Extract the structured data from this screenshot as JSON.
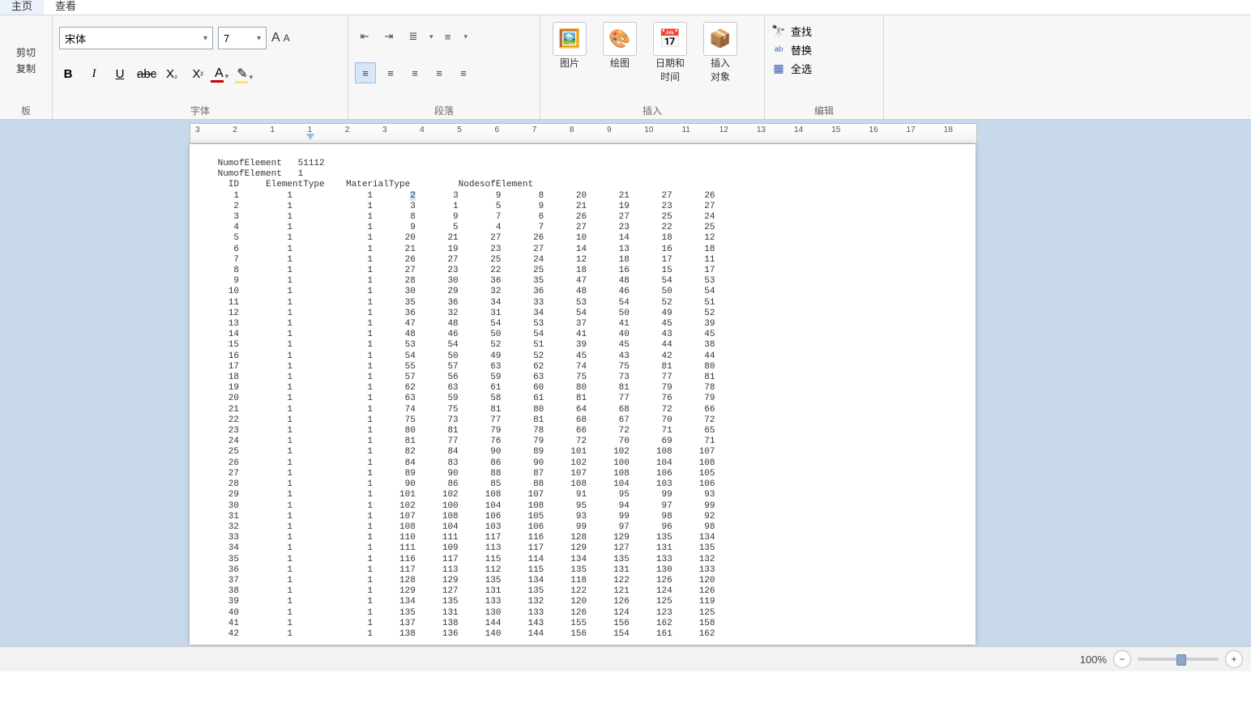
{
  "tabs": {
    "home": "主页",
    "view": "查看"
  },
  "clipboard": {
    "cut": "剪切",
    "copy": "复制",
    "group": "板"
  },
  "font": {
    "name": "宋体",
    "size": "7",
    "group": "字体",
    "bold": "B",
    "italic": "I",
    "underline": "U",
    "strike": "abc",
    "sub": "X",
    "sup": "X"
  },
  "paragraph": {
    "group": "段落"
  },
  "insert": {
    "picture": "图片",
    "paint": "绘图",
    "datetime": "日期和\n时间",
    "object": "插入\n对象",
    "group": "插入"
  },
  "edit": {
    "find": "查找",
    "replace": "替换",
    "selectall": "全选",
    "group": "编辑"
  },
  "ruler": [
    "3",
    "2",
    "1",
    "1",
    "2",
    "3",
    "4",
    "5",
    "6",
    "7",
    "8",
    "9",
    "10",
    "11",
    "12",
    "13",
    "14",
    "15",
    "16",
    "17",
    "18"
  ],
  "status": {
    "zoom": "100%"
  },
  "doc": {
    "header1": "NumofElement   51112",
    "header2": "NumofElement   1",
    "colhead": "   ID     ElementType    MaterialType         NodesofElement",
    "highlight": "2",
    "rows": [
      [
        "1",
        "1",
        "1",
        "2",
        "3",
        "9",
        "8",
        "20",
        "21",
        "27",
        "26"
      ],
      [
        "2",
        "1",
        "1",
        "3",
        "1",
        "5",
        "9",
        "21",
        "19",
        "23",
        "27"
      ],
      [
        "3",
        "1",
        "1",
        "8",
        "9",
        "7",
        "6",
        "26",
        "27",
        "25",
        "24"
      ],
      [
        "4",
        "1",
        "1",
        "9",
        "5",
        "4",
        "7",
        "27",
        "23",
        "22",
        "25"
      ],
      [
        "5",
        "1",
        "1",
        "20",
        "21",
        "27",
        "26",
        "10",
        "14",
        "18",
        "12"
      ],
      [
        "6",
        "1",
        "1",
        "21",
        "19",
        "23",
        "27",
        "14",
        "13",
        "16",
        "18"
      ],
      [
        "7",
        "1",
        "1",
        "26",
        "27",
        "25",
        "24",
        "12",
        "18",
        "17",
        "11"
      ],
      [
        "8",
        "1",
        "1",
        "27",
        "23",
        "22",
        "25",
        "18",
        "16",
        "15",
        "17"
      ],
      [
        "9",
        "1",
        "1",
        "28",
        "30",
        "36",
        "35",
        "47",
        "48",
        "54",
        "53"
      ],
      [
        "10",
        "1",
        "1",
        "30",
        "29",
        "32",
        "36",
        "48",
        "46",
        "50",
        "54"
      ],
      [
        "11",
        "1",
        "1",
        "35",
        "36",
        "34",
        "33",
        "53",
        "54",
        "52",
        "51"
      ],
      [
        "12",
        "1",
        "1",
        "36",
        "32",
        "31",
        "34",
        "54",
        "50",
        "49",
        "52"
      ],
      [
        "13",
        "1",
        "1",
        "47",
        "48",
        "54",
        "53",
        "37",
        "41",
        "45",
        "39"
      ],
      [
        "14",
        "1",
        "1",
        "48",
        "46",
        "50",
        "54",
        "41",
        "40",
        "43",
        "45"
      ],
      [
        "15",
        "1",
        "1",
        "53",
        "54",
        "52",
        "51",
        "39",
        "45",
        "44",
        "38"
      ],
      [
        "16",
        "1",
        "1",
        "54",
        "50",
        "49",
        "52",
        "45",
        "43",
        "42",
        "44"
      ],
      [
        "17",
        "1",
        "1",
        "55",
        "57",
        "63",
        "62",
        "74",
        "75",
        "81",
        "80"
      ],
      [
        "18",
        "1",
        "1",
        "57",
        "56",
        "59",
        "63",
        "75",
        "73",
        "77",
        "81"
      ],
      [
        "19",
        "1",
        "1",
        "62",
        "63",
        "61",
        "60",
        "80",
        "81",
        "79",
        "78"
      ],
      [
        "20",
        "1",
        "1",
        "63",
        "59",
        "58",
        "61",
        "81",
        "77",
        "76",
        "79"
      ],
      [
        "21",
        "1",
        "1",
        "74",
        "75",
        "81",
        "80",
        "64",
        "68",
        "72",
        "66"
      ],
      [
        "22",
        "1",
        "1",
        "75",
        "73",
        "77",
        "81",
        "68",
        "67",
        "70",
        "72"
      ],
      [
        "23",
        "1",
        "1",
        "80",
        "81",
        "79",
        "78",
        "66",
        "72",
        "71",
        "65"
      ],
      [
        "24",
        "1",
        "1",
        "81",
        "77",
        "76",
        "79",
        "72",
        "70",
        "69",
        "71"
      ],
      [
        "25",
        "1",
        "1",
        "82",
        "84",
        "90",
        "89",
        "101",
        "102",
        "108",
        "107"
      ],
      [
        "26",
        "1",
        "1",
        "84",
        "83",
        "86",
        "90",
        "102",
        "100",
        "104",
        "108"
      ],
      [
        "27",
        "1",
        "1",
        "89",
        "90",
        "88",
        "87",
        "107",
        "108",
        "106",
        "105"
      ],
      [
        "28",
        "1",
        "1",
        "90",
        "86",
        "85",
        "88",
        "108",
        "104",
        "103",
        "106"
      ],
      [
        "29",
        "1",
        "1",
        "101",
        "102",
        "108",
        "107",
        "91",
        "95",
        "99",
        "93"
      ],
      [
        "30",
        "1",
        "1",
        "102",
        "100",
        "104",
        "108",
        "95",
        "94",
        "97",
        "99"
      ],
      [
        "31",
        "1",
        "1",
        "107",
        "108",
        "106",
        "105",
        "93",
        "99",
        "98",
        "92"
      ],
      [
        "32",
        "1",
        "1",
        "108",
        "104",
        "103",
        "106",
        "99",
        "97",
        "96",
        "98"
      ],
      [
        "33",
        "1",
        "1",
        "110",
        "111",
        "117",
        "116",
        "128",
        "129",
        "135",
        "134"
      ],
      [
        "34",
        "1",
        "1",
        "111",
        "109",
        "113",
        "117",
        "129",
        "127",
        "131",
        "135"
      ],
      [
        "35",
        "1",
        "1",
        "116",
        "117",
        "115",
        "114",
        "134",
        "135",
        "133",
        "132"
      ],
      [
        "36",
        "1",
        "1",
        "117",
        "113",
        "112",
        "115",
        "135",
        "131",
        "130",
        "133"
      ],
      [
        "37",
        "1",
        "1",
        "128",
        "129",
        "135",
        "134",
        "118",
        "122",
        "126",
        "120"
      ],
      [
        "38",
        "1",
        "1",
        "129",
        "127",
        "131",
        "135",
        "122",
        "121",
        "124",
        "126"
      ],
      [
        "39",
        "1",
        "1",
        "134",
        "135",
        "133",
        "132",
        "120",
        "126",
        "125",
        "119"
      ],
      [
        "40",
        "1",
        "1",
        "135",
        "131",
        "130",
        "133",
        "126",
        "124",
        "123",
        "125"
      ],
      [
        "41",
        "1",
        "1",
        "137",
        "138",
        "144",
        "143",
        "155",
        "156",
        "162",
        "158"
      ],
      [
        "42",
        "1",
        "1",
        "138",
        "136",
        "140",
        "144",
        "156",
        "154",
        "161",
        "162"
      ]
    ]
  }
}
